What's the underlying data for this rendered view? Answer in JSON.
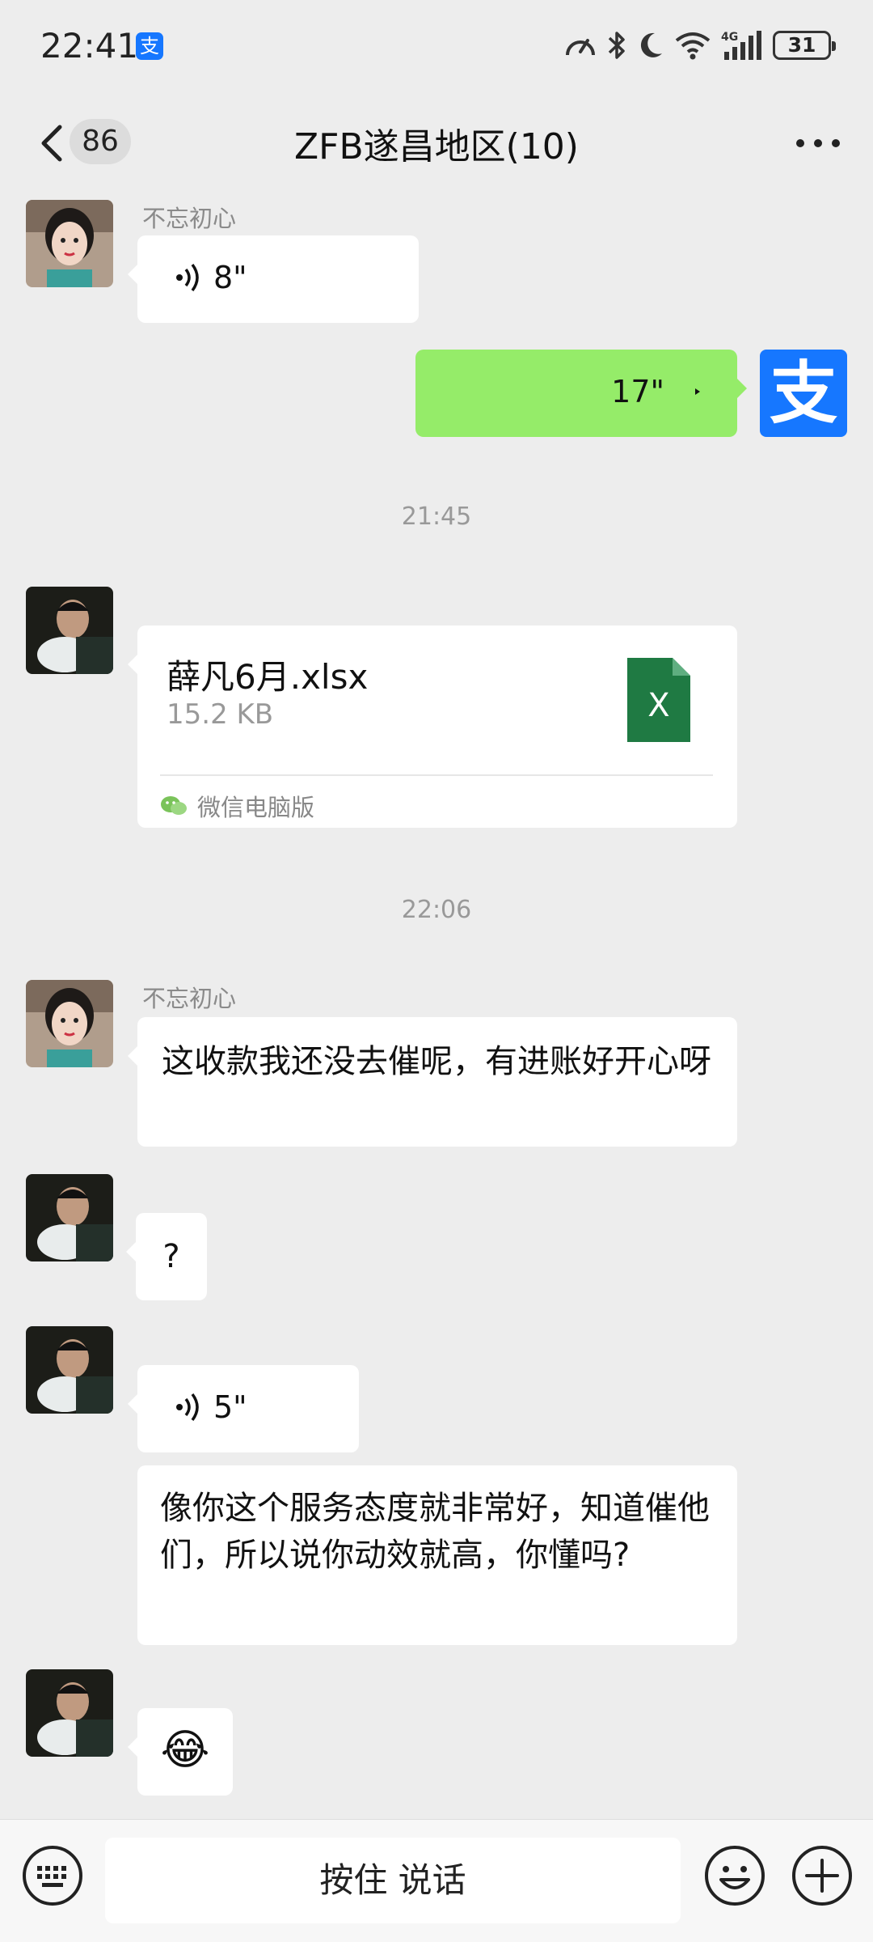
{
  "status": {
    "time": "22:41",
    "notification_glyph": "支",
    "battery": "31"
  },
  "nav": {
    "back_count": "86",
    "title": "ZFB遂昌地区(10)"
  },
  "messages": {
    "m1": {
      "sender": "不忘初心",
      "voice_duration": "8\""
    },
    "m2": {
      "voice_duration": "17\"",
      "self_avatar_glyph": "支"
    },
    "t1": "21:45",
    "m3": {
      "file_name": "薛凡6月.xlsx",
      "file_size": "15.2 KB",
      "file_glyph": "X",
      "source": "微信电脑版"
    },
    "t2": "22:06",
    "m4": {
      "sender": "不忘初心",
      "text": "这收款我还没去催呢，有进账好开心呀"
    },
    "m5": {
      "text": "?"
    },
    "m6": {
      "voice_duration": "5\""
    },
    "m7": {
      "text": "像你这个服务态度就非常好，知道催他们，所以说你动效就高，你懂吗?"
    },
    "m8": {
      "emoji": "😂"
    }
  },
  "input": {
    "hold_to_talk": "按住 说话"
  },
  "colors": {
    "background": "#ededed",
    "bubble_self": "#95ec69",
    "bubble_other": "#ffffff",
    "alipay_blue": "#1677ff",
    "excel_green": "#1f7a43"
  }
}
